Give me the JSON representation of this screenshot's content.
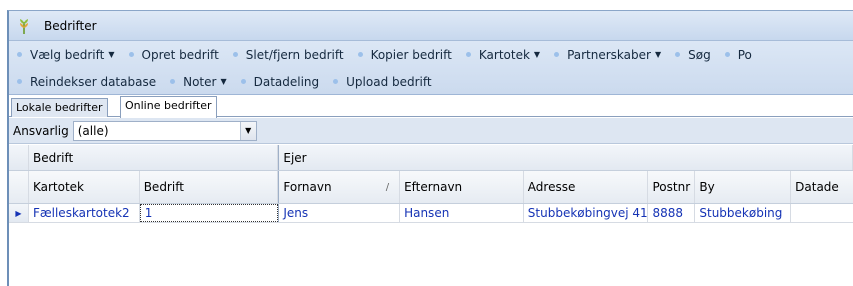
{
  "window": {
    "title": "Bedrifter",
    "icon": "wheat-icon",
    "accent": "#7fae3a"
  },
  "toolbar": {
    "row1": [
      {
        "label": "Vælg bedrift",
        "dropdown": true
      },
      {
        "label": "Opret bedrift",
        "dropdown": false
      },
      {
        "label": "Slet/fjern bedrift",
        "dropdown": false
      },
      {
        "label": "Kopier bedrift",
        "dropdown": false
      },
      {
        "label": "Kartotek",
        "dropdown": true
      },
      {
        "label": "Partnerskaber",
        "dropdown": true
      },
      {
        "label": "Søg",
        "dropdown": false
      },
      {
        "label": "Po",
        "dropdown": false
      }
    ],
    "row2": [
      {
        "label": "Reindekser database",
        "dropdown": false
      },
      {
        "label": "Noter",
        "dropdown": true
      },
      {
        "label": "Datadeling",
        "dropdown": false
      },
      {
        "label": "Upload bedrift",
        "dropdown": false
      }
    ]
  },
  "tabs": [
    "Lokale bedrifter",
    "Online bedrifter"
  ],
  "active_tab": "Online bedrifter",
  "filter": {
    "label": "Ansvarlig",
    "value": "(alle)"
  },
  "grid": {
    "bands": [
      "Bedrift",
      "Ejer"
    ],
    "columns": [
      "Kartotek",
      "Bedrift",
      "Fornavn",
      "Efternavn",
      "Adresse",
      "Postnr",
      "By",
      "Datade"
    ],
    "rows": [
      [
        "Fælleskartotek2",
        "1",
        "Jens",
        "Hansen",
        "Stubbekøbingvej 41",
        "8888",
        "Stubbekøbing",
        ""
      ]
    ]
  }
}
